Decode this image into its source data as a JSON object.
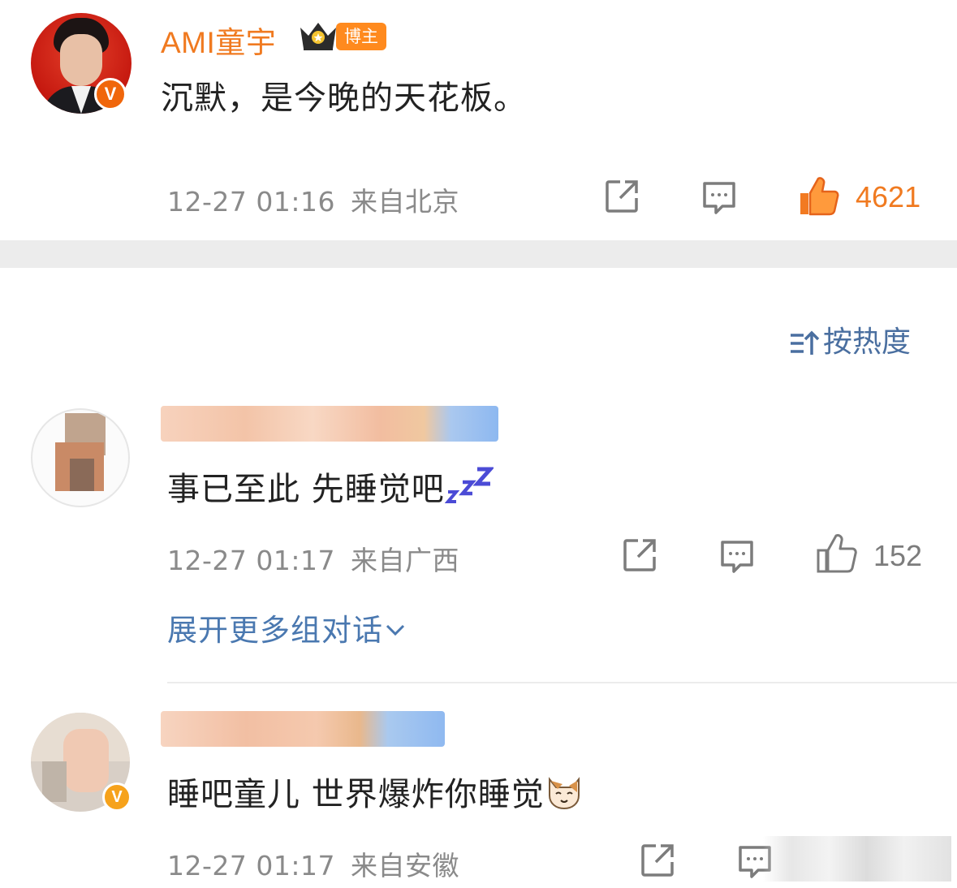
{
  "post": {
    "author_name": "AMI童宇",
    "author_badge": "博主",
    "verified_mark": "V",
    "text": "沉默，是今晚的天花板。",
    "timestamp": "12-27 01:16",
    "location": "来自北京",
    "like_count": "4621",
    "liked": true
  },
  "sort": {
    "label": "按热度",
    "icon": "sort-icon"
  },
  "comments": [
    {
      "text": "事已至此 先睡觉吧",
      "emoji": "zzz-sleep-emoji",
      "timestamp": "12-27 01:17",
      "location": "来自广西",
      "like_count": "152"
    },
    {
      "text": "睡吧童儿 世界爆炸你睡觉",
      "emoji": "cat-face-emoji",
      "timestamp": "12-27 01:17",
      "location": "来自安徽",
      "verified_mark": "V"
    }
  ],
  "expand_label": "展开更多组对话",
  "colors": {
    "accent_orange": "#f07a20",
    "link_blue": "#4a78b0",
    "meta_gray": "#8a8a8a"
  }
}
